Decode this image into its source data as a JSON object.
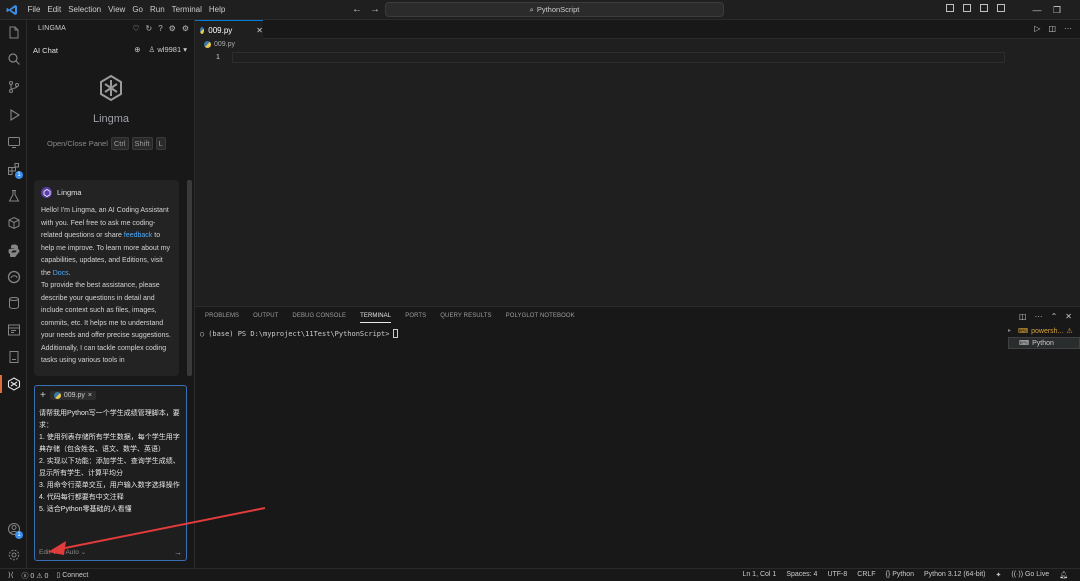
{
  "titlebar": {
    "menu": [
      "File",
      "Edit",
      "Selection",
      "View",
      "Go",
      "Run",
      "Terminal",
      "Help"
    ],
    "search_text": "PythonScript"
  },
  "sidepanel": {
    "title": "LINGMA",
    "tab": "AI Chat",
    "user": "wl9981",
    "brand": "Lingma",
    "shortcut_label": "Open/Close Panel",
    "shortcut_keys": [
      "Ctrl",
      "Shift",
      "L"
    ],
    "chat": {
      "sender": "Lingma",
      "p1_a": "Hello! I'm Lingma, an AI Coding Assistant with you. Feel free to ask me coding-related questions or share ",
      "p1_link": "feedback",
      "p1_b": " to help me improve. To learn more about my capabilities, updates, and Editions, visit the ",
      "p1_link2": "Docs",
      "p1_c": ".",
      "p2": "To provide the best assistance, please describe your questions in detail and include context such as files, images, commits, etc. It helps me to understand your needs and offer precise suggestions.",
      "p3": "Additionally, I can tackle complex coding tasks using various tools in"
    },
    "input": {
      "file_chip": "009.py",
      "prompt_lines": [
        "请帮我用Python写一个学生成绩管理脚本，要求：",
        "1. 使用列表存储所有学生数据，每个学生用字典存储（包含姓名、语文、数学、英语）",
        "2. 实现以下功能：添加学生、查询学生成绩、显示所有学生、计算平均分",
        "3. 用命令行菜单交互，用户输入数字选择操作",
        "4. 代码每行都要有中文注释",
        "5. 适合Python零基础的人看懂"
      ],
      "mode": "Edit",
      "model": "Auto"
    }
  },
  "editor": {
    "tab": "009.py",
    "breadcrumb": "009.py",
    "line_number": "1"
  },
  "panel": {
    "tabs": [
      "PROBLEMS",
      "OUTPUT",
      "DEBUG CONSOLE",
      "TERMINAL",
      "PORTS",
      "QUERY RESULTS",
      "POLYGLOT NOTEBOOK"
    ],
    "active_tab": "TERMINAL",
    "prompt": "(base) PS D:\\myproject\\11Test\\PythonScript>",
    "terminals": [
      "powersh...",
      "Python"
    ]
  },
  "statusbar": {
    "errors": "0",
    "warnings": "0",
    "connect": "Connect",
    "position": "Ln 1, Col 1",
    "spaces": "Spaces: 4",
    "encoding": "UTF-8",
    "eol": "CRLF",
    "language": "Python",
    "interpreter": "Python 3.12 (64-bit)",
    "golive": "Go Live"
  },
  "colors": {
    "accent": "#0078d4",
    "annotation": "#e23b3b",
    "link": "#4daafc"
  }
}
